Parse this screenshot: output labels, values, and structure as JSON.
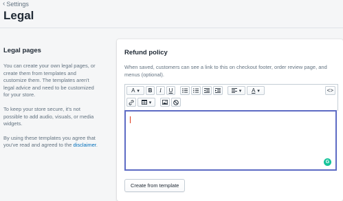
{
  "header": {
    "breadcrumb": "Settings",
    "title": "Legal"
  },
  "sidebar": {
    "title": "Legal pages",
    "paragraphs": [
      "You can create your own legal pages, or create them from templates and customize them. The templates aren't legal advice and need to be customized for your store.",
      "To keep your store secure, it's not possible to add audio, visuals, or media widgets."
    ],
    "agree_text": "By using these templates you agree that you've read and agreed to the ",
    "agree_link": "disclaimer",
    "agree_end": "."
  },
  "card": {
    "title": "Refund policy",
    "description": "When saved, customers can see a link to this on checkout footer, order review page, and menus (optional).",
    "template_button": "Create from template"
  },
  "toolbar": {
    "font_label": "A",
    "bold": "B",
    "italic": "I",
    "underline": "U",
    "color_label": "A",
    "html_label": "<>"
  },
  "icons": {
    "back": "chevron-left-icon",
    "link": "link-icon",
    "table": "table-icon",
    "image": "image-icon",
    "clear": "clear-format-icon",
    "grammarly": "grammarly-icon"
  }
}
